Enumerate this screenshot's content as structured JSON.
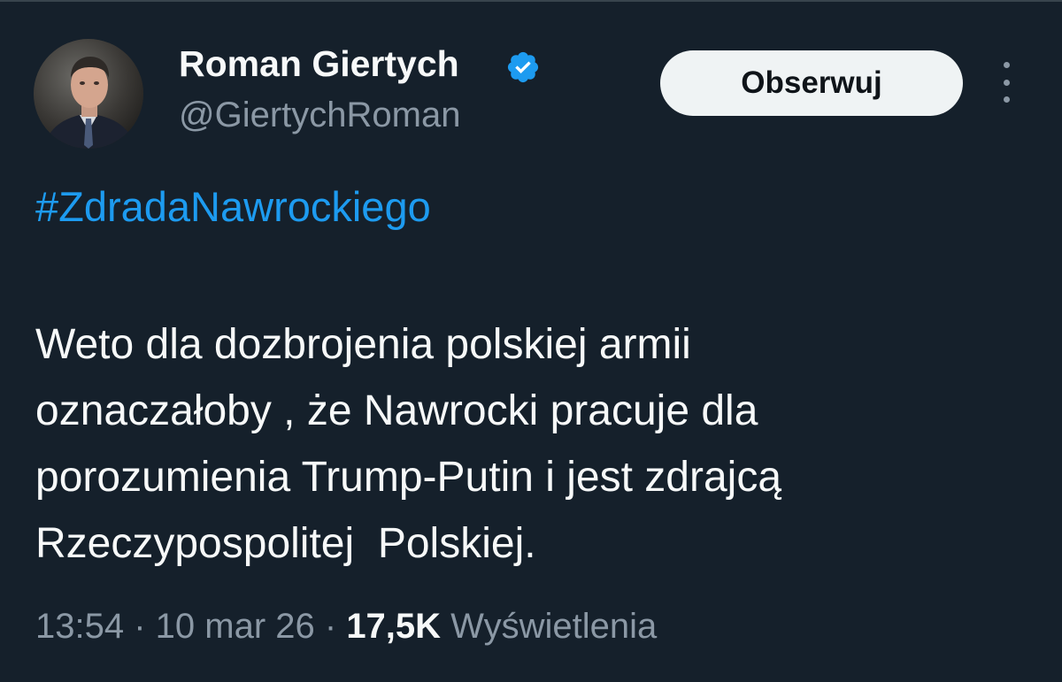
{
  "author": {
    "display_name": "Roman Giertych",
    "handle": "@GiertychRoman",
    "verified_icon": "verified-badge-icon",
    "verified_color": "#1d9bf0"
  },
  "actions": {
    "follow_label": "Obserwuj",
    "more_icon": "more-vertical-icon"
  },
  "tweet": {
    "hashtag": "#ZdradaNawrockiego",
    "lines": [
      "Weto dla dozbrojenia polskiej armii",
      "oznaczałoby , że Nawrocki pracuje dla",
      "porozumienia Trump-Putin i jest zdrajcą",
      "Rzeczypospolitej  Polskiej."
    ]
  },
  "meta": {
    "time": "13:54",
    "sep1": " · ",
    "date": "10 mar 26",
    "sep2": " · ",
    "views_count": "17,5K",
    "views_label": " Wyświetlenia"
  },
  "colors": {
    "background": "#15202b",
    "text": "#f7f9f9",
    "secondary": "#8b98a5",
    "accent": "#1d9bf0"
  }
}
